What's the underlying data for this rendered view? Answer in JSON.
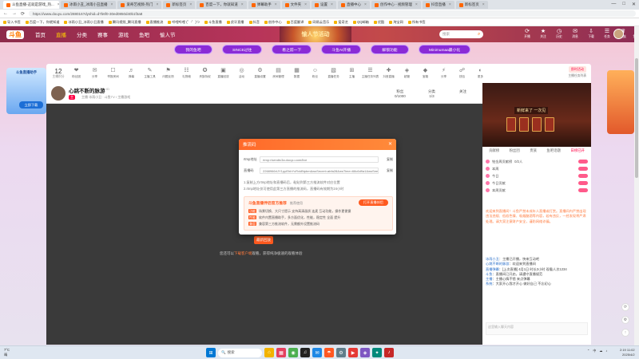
{
  "browser": {
    "tabs": [
      {
        "label": "斗鱼直播-这就是游戏_热...",
        "active": true
      },
      {
        "label": "冰雨小丑_冰雨小丑直播"
      },
      {
        "label": "爱奇艺视频-热门"
      },
      {
        "label": "新标签页"
      },
      {
        "label": "百度一下，你就知道"
      },
      {
        "label": "弹幕助手"
      },
      {
        "label": "文件夹"
      },
      {
        "label": "设置"
      },
      {
        "label": "直播中心"
      },
      {
        "label": "创作中心 - 视频管理"
      },
      {
        "label": "抖音直播"
      },
      {
        "label": "新标签页"
      }
    ],
    "url": "https://www.douyu.com/288016?dyshid=d7b6f0-30ed0850d40b1f3a8",
    "bookmarks": [
      "导入书签",
      "百度一下，你就知道",
      "冰雨小丑_冰雨小丑直播",
      "腾讯视频_腾讯直播",
      "直播推流",
      "哔哩哔哩 (゜-゜)つ",
      "斗鱼直播",
      "虎牙直播",
      "抖音",
      "创作中心",
      "百度翻译",
      "网易云音乐",
      "爱奇艺",
      "QQ邮箱",
      "优酷",
      "淘宝网",
      "所有书签"
    ],
    "window_controls": [
      "—",
      "□",
      "✕"
    ],
    "nav": [
      "←",
      "→",
      "⟳"
    ]
  },
  "site": {
    "logo": "斗鱼",
    "nav": [
      {
        "label": "首页"
      },
      {
        "label": "直播",
        "on": true
      },
      {
        "label": "分类"
      },
      {
        "label": "赛事"
      },
      {
        "label": "游戏"
      },
      {
        "label": "鱼吧"
      },
      {
        "label": "愉人节"
      }
    ],
    "banner_text": "愉人节活动",
    "search_placeholder": "搜索",
    "header_icons": [
      {
        "icon": "⟳",
        "label": "开播"
      },
      {
        "icon": "★",
        "label": "关注"
      },
      {
        "icon": "◷",
        "label": "历史"
      },
      {
        "icon": "✉",
        "label": "消息"
      },
      {
        "icon": "⇩",
        "label": "下载"
      },
      {
        "icon": "☰",
        "label": "任务"
      },
      {
        "icon": "♛",
        "label": "贵族"
      },
      {
        "icon": "✧",
        "label": "鱼翅充值"
      },
      {
        "icon": "☺",
        "label": "个人"
      }
    ]
  },
  "pills": [
    "我的鱼吧",
    "SINCE过往",
    "看之前一下",
    "斗鱼AI开播",
    "解锁功能",
    "Minimumaa最小化"
  ],
  "left_float": {
    "title": "斗鱼直播助手",
    "button": "立即下载"
  },
  "toolbar": {
    "count": "12",
    "count_label": "主播积分",
    "items": [
      {
        "icon": "❤",
        "label": "粉丝团"
      },
      {
        "icon": "✉",
        "label": "分享"
      },
      {
        "icon": "☐",
        "label": "举报房间"
      },
      {
        "icon": "♬",
        "label": "弹幕"
      },
      {
        "icon": "✎",
        "label": "主播工具"
      },
      {
        "icon": "⚑",
        "label": "问题反馈"
      },
      {
        "icon": "☷",
        "label": "礼物墙"
      },
      {
        "icon": "✪",
        "label": "贵族特权"
      },
      {
        "icon": "▣",
        "label": "直播回放"
      },
      {
        "icon": "◎",
        "label": "活动"
      },
      {
        "icon": "⚙",
        "label": "直播设置"
      },
      {
        "icon": "▤",
        "label": "房间管理"
      },
      {
        "icon": "▦",
        "label": "数据"
      },
      {
        "icon": "☺",
        "label": "粉丝"
      },
      {
        "icon": "▧",
        "label": "直播任务"
      },
      {
        "icon": "⊞",
        "label": "主播"
      },
      {
        "icon": "☰",
        "label": "主播任务列表"
      },
      {
        "icon": "✚",
        "label": "抖音直播"
      },
      {
        "icon": "◈",
        "label": "超管"
      },
      {
        "icon": "◆",
        "label": "宝箱"
      },
      {
        "icon": "⚡",
        "label": "分享"
      },
      {
        "icon": "☍",
        "label": "钱包"
      },
      {
        "icon": "◐",
        "label": "更多"
      }
    ],
    "tag": "即时活动",
    "small": "主播任务列表"
  },
  "streamer": {
    "name": "心跳不断的脉游",
    "level": "ID",
    "badge": "主",
    "meta": "主播 冰雨小丑 · 斗鱼TV / 主播游戏",
    "fans": "0/1000",
    "fans_label": "粉丝",
    "rank": "1/3",
    "rank_label": "分类",
    "follow": "关注",
    "extra_label": "1个榜",
    "extra_value": "直播好友"
  },
  "modal": {
    "title": "推流码",
    "close": "✕",
    "rtmp_label": "rtmp地址",
    "rtmp_value": "rtmp://sendtc3a.douyu.com/live",
    "key_label": "直播码",
    "key_value": "2268966rIJY1ppEhbYcRvkBtpbm&wsSecret=abfa28&wsTime=68c6d9a1&wsSeek=0&...",
    "copy": "复制",
    "note1": "1.复制上方rtmp地址和直播码后，粘贴到第三方推流软件对应位置",
    "note2": "2.rtmp地址仅可使用此第三方直播的推流码，直播码有效期为24小时",
    "promo_title": "斗鱼直播伴侣官方推荐",
    "promo_sub": "推荐使用",
    "promo_button": "打开直播伴侣",
    "promo_lines": [
      {
        "tag": "功能",
        "text": "场景切换、大尺寸提示 支持高清画质 连麦 互动功能，操作更便捷"
      },
      {
        "tag": "性能",
        "text": "软件内置直播助手，多方面优化，性能，稳定性 全面 提升"
      },
      {
        "tag": "兼容",
        "text": "兼容第三方推流软件，无需额外设置推流码"
      }
    ]
  },
  "player": {
    "cta": "最新回放",
    "hint_pre": "您还可以",
    "hint_link": "下载客户端",
    "hint_post": "观看，获得纯净极速的观看体验"
  },
  "chat": {
    "game_title": "新鲜来了 一次见",
    "tabs": [
      "贡献榜",
      "粉丝团",
      "贵族",
      "鱼吧话题",
      "日榜已开"
    ],
    "active_tab": "日榜已开",
    "rows": [
      {
        "label": "铂金周贡献榜",
        "value": "0/2人"
      },
      {
        "label": "本周",
        "value": ""
      },
      {
        "label": "今日",
        "value": ""
      },
      {
        "label": "今日贡献",
        "value": ""
      },
      {
        "label": "本周贡献",
        "value": ""
      }
    ],
    "system_msg": "欢迎来到直播间！斗鱼严禁未成年人直播或打赏。直播间内严禁出现违法违规、低俗色情、吸烟酗酒等内容，若有违反，一经发现将严肃处理。请大家注意财产安全，谨防网络诈骗。",
    "messages": [
      {
        "name": "冰雨小丑",
        "text": "主播已开播，快来互动吧"
      },
      {
        "name": "心跳不断的脉游",
        "text": "欢迎来到直播间"
      },
      {
        "name": "直播弹幕",
        "text": "[上次直播] 4月1日 时长3小时 观看人次1234"
      },
      {
        "name": "斗鱼",
        "text": "直播间已开启，请遵守直播规范"
      },
      {
        "name": "主播",
        "text": "主播心情不错 来点弹幕"
      },
      {
        "name": "系统",
        "text": "大家开心我才开心 做好自己 不忘初心"
      }
    ],
    "input_placeholder": "这里输入聊天内容"
  },
  "taskbar": {
    "weather_temp": "7°C",
    "weather_desc": "晴",
    "search": "搜索",
    "apps": [
      "⊞",
      "🔍",
      "⌂",
      "▦",
      "◉",
      "♫",
      "✉",
      "☂",
      "⚙",
      "▶",
      "◈",
      "✦",
      "♪"
    ],
    "tray": [
      "⌃",
      "中",
      "☁",
      "♪"
    ],
    "time": "2:19 11:02",
    "date": "2025/4/2"
  }
}
